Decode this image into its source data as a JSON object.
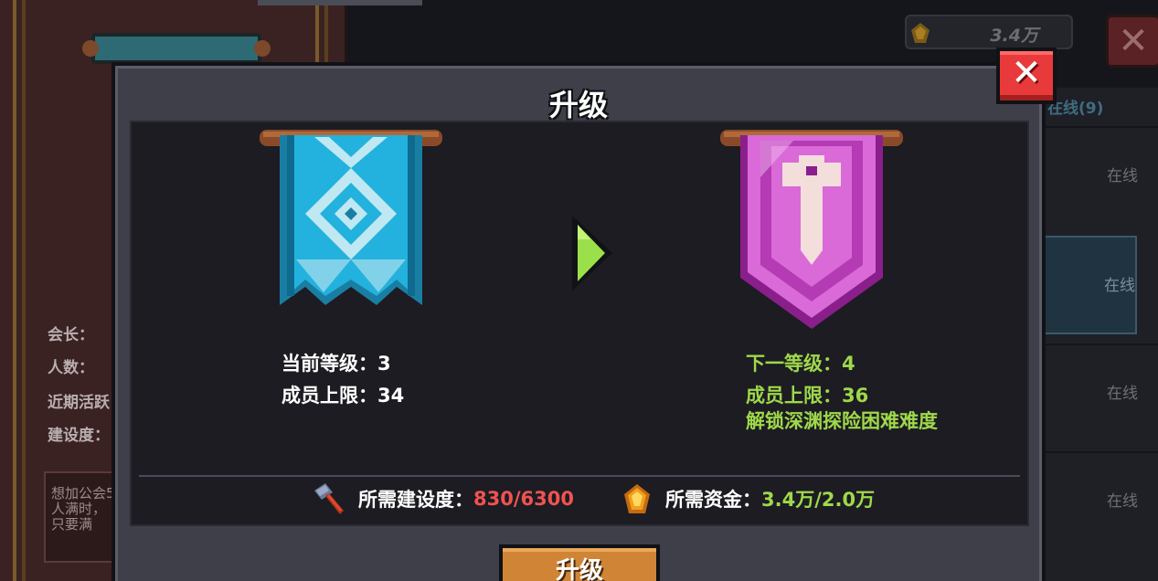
{
  "colors": {
    "dialog_bg": "#3e3f49",
    "content_bg": "#1c1c22",
    "accent_green": "#9fd84a",
    "accent_red": "#f05252",
    "button_orange": "#d08436",
    "close_red": "#e83a3a"
  },
  "background": {
    "guild_info": [
      {
        "label": "会长："
      },
      {
        "label": "人数："
      },
      {
        "label": "近期活跃"
      },
      {
        "label": "建设度："
      }
    ],
    "description": "想加公会5人满时，只要满",
    "currency_amount": "3.4万",
    "online_filter": "在线(9)",
    "member_status": [
      "在线",
      "在线",
      "在线",
      "在线"
    ],
    "close_icon": "close-icon"
  },
  "dialog": {
    "title": "升级",
    "current": {
      "level_text": "当前等级：3",
      "member_limit_text": "成员上限：34",
      "banner_icon": "blue-guild-banner-icon"
    },
    "next": {
      "level_text": "下一等级：4",
      "member_limit_text": "成员上限：36",
      "unlock_text": "解锁深渊探险困难难度",
      "banner_icon": "purple-guild-banner-icon"
    },
    "arrow_icon": "arrow-right-icon",
    "costs": {
      "construction_label": "所需建设度：",
      "construction_value": "830/6300",
      "construction_icon": "hammer-icon",
      "funds_label": "所需资金：",
      "funds_value": "3.4万/2.0万",
      "funds_icon": "gold-gem-icon"
    },
    "upgrade_button": "升级",
    "close_icon": "close-icon"
  }
}
